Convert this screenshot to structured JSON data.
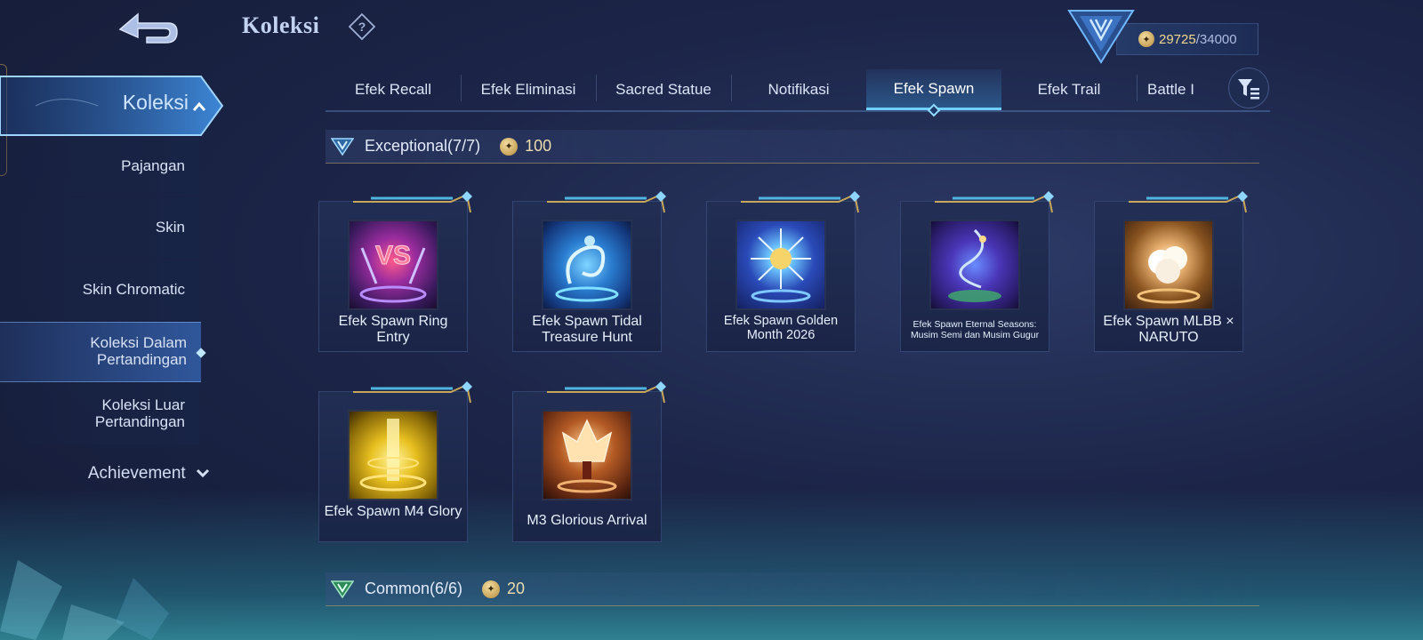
{
  "header": {
    "title": "Koleksi",
    "points_current": "29725",
    "points_separator": "/",
    "points_max": "34000"
  },
  "sidebar": {
    "main_label": "Koleksi",
    "items": [
      {
        "label": "Pajangan"
      },
      {
        "label": "Skin"
      },
      {
        "label": "Skin Chromatic"
      },
      {
        "label": "Koleksi Dalam Pertandingan",
        "selected": true
      },
      {
        "label": "Koleksi Luar Pertandingan"
      }
    ],
    "achievement_label": "Achievement"
  },
  "tabs": [
    {
      "label": "Efek Recall"
    },
    {
      "label": "Efek Eliminasi"
    },
    {
      "label": "Sacred Statue"
    },
    {
      "label": "Notifikasi"
    },
    {
      "label": "Efek Spawn",
      "active": true
    },
    {
      "label": "Efek Trail"
    },
    {
      "label": "Battle I"
    }
  ],
  "sections": [
    {
      "title": "Exceptional(7/7)",
      "cost": "100",
      "cards": [
        {
          "title": "Efek Spawn Ring Entry"
        },
        {
          "title": "Efek Spawn Tidal Treasure Hunt"
        },
        {
          "title": "Efek Spawn Golden Month 2026"
        },
        {
          "title": "Efek Spawn Eternal Seasons: Musim Semi dan Musim Gugur"
        },
        {
          "title": "Efek Spawn MLBB × NARUTO"
        },
        {
          "title": "Efek Spawn M4 Glory"
        },
        {
          "title": "M3 Glorious Arrival"
        }
      ]
    },
    {
      "title": "Common(6/6)",
      "cost": "20"
    }
  ],
  "colors": {
    "accent": "#6fd0ff",
    "gold": "#f2d68e",
    "background": "#1c2548"
  },
  "icons": {
    "back": "back-arrow-icon",
    "help": "question-diamond-icon",
    "filter": "filter-icon",
    "coin": "coin-icon",
    "rank": "rank-emblem-icon"
  }
}
